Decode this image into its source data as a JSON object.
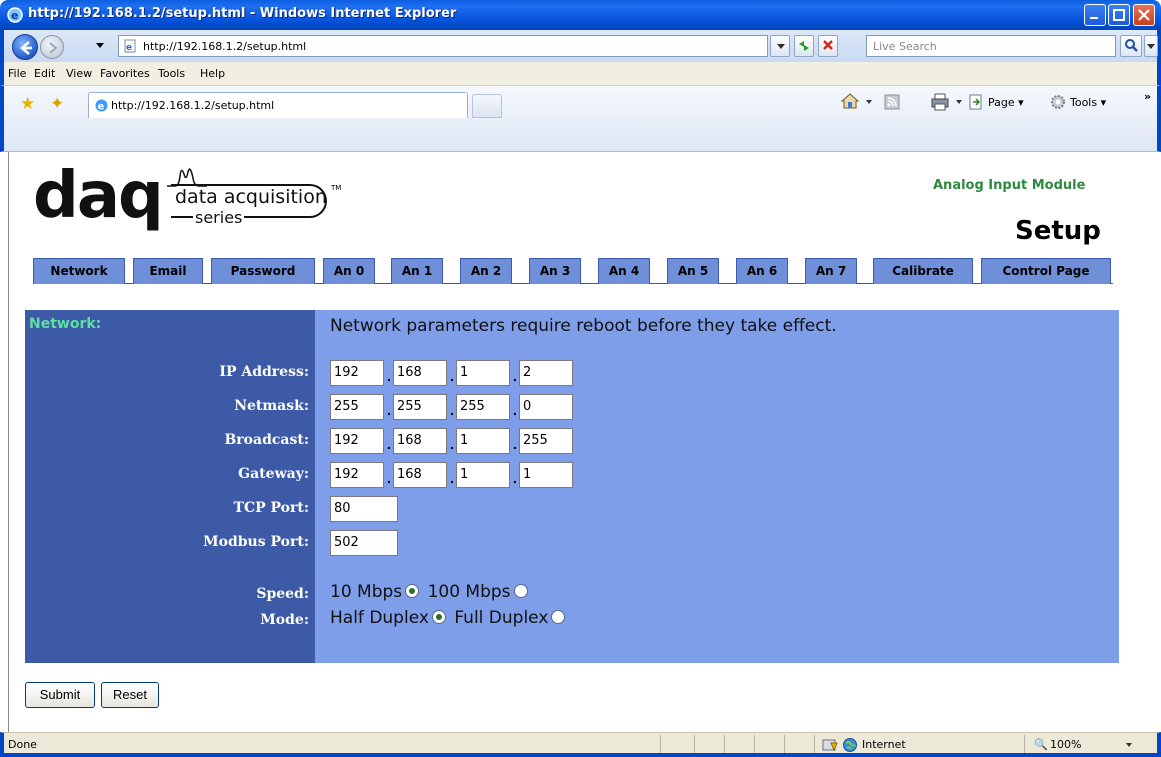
{
  "window": {
    "title": "http://192.168.1.2/setup.html - Windows Internet Explorer"
  },
  "address_bar": {
    "url": "http://192.168.1.2/setup.html",
    "search_placeholder": "Live Search"
  },
  "menu": [
    "File",
    "Edit",
    "View",
    "Favorites",
    "Tools",
    "Help"
  ],
  "tab": {
    "title": "http://192.168.1.2/setup.html"
  },
  "command_bar": {
    "page_label": "Page",
    "tools_label": "Tools"
  },
  "logo": {
    "main": "daq",
    "line1": "data acquisition",
    "line2": "series",
    "tm": "TM"
  },
  "header": {
    "module_name": "Analog Input Module",
    "page_title": "Setup"
  },
  "nav_tabs": [
    "Network",
    "Email",
    "Password",
    "An 0",
    "An 1",
    "An 2",
    "An 3",
    "An 4",
    "An 5",
    "An 6",
    "An 7",
    "Calibrate",
    "Control Page"
  ],
  "form": {
    "section_title": "Network:",
    "notice": "Network parameters require reboot before they take effect.",
    "ip_address": {
      "label": "IP Address:",
      "octets": [
        "192",
        "168",
        "1",
        "2"
      ]
    },
    "netmask": {
      "label": "Netmask:",
      "octets": [
        "255",
        "255",
        "255",
        "0"
      ]
    },
    "broadcast": {
      "label": "Broadcast:",
      "octets": [
        "192",
        "168",
        "1",
        "255"
      ]
    },
    "gateway": {
      "label": "Gateway:",
      "octets": [
        "192",
        "168",
        "1",
        "1"
      ]
    },
    "tcp_port": {
      "label": "TCP Port:",
      "value": "80"
    },
    "modbus_port": {
      "label": "Modbus Port:",
      "value": "502"
    },
    "speed": {
      "label": "Speed:",
      "options": [
        "10 Mbps",
        "100 Mbps"
      ],
      "selected": "10 Mbps"
    },
    "mode": {
      "label": "Mode:",
      "options": [
        "Half Duplex",
        "Full Duplex"
      ],
      "selected": "Half Duplex"
    },
    "dot": "."
  },
  "buttons": {
    "submit": "Submit",
    "reset": "Reset"
  },
  "status_bar": {
    "status": "Done",
    "zone": "Internet",
    "zoom": "100%"
  },
  "colors": {
    "panel_dark": "#3d5aa7",
    "panel_light": "#7e9ee9",
    "tab_fill": "#6f8fd8",
    "section_title": "#5ee0a0",
    "module_name": "#2d8a3e"
  }
}
